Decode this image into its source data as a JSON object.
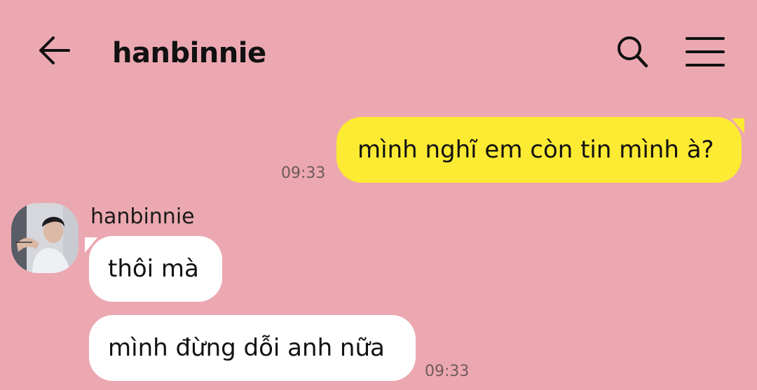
{
  "header": {
    "title": "hanbinnie",
    "back_icon": "arrow-left-icon",
    "search_icon": "search-icon",
    "menu_icon": "hamburger-menu-icon"
  },
  "messages": [
    {
      "direction": "outgoing",
      "text": "mình nghĩ em còn tin mình à?",
      "time": "09:33",
      "bubble_color": "#fdea33"
    },
    {
      "direction": "incoming",
      "sender": "hanbinnie",
      "text": "thôi mà",
      "bubble_color": "#ffffff"
    },
    {
      "direction": "incoming",
      "text": "mình đừng dỗi anh nữa",
      "time": "09:33",
      "bubble_color": "#ffffff"
    }
  ],
  "colors": {
    "background": "#eca8b1",
    "outgoing_bubble": "#fdea33",
    "incoming_bubble": "#ffffff"
  }
}
